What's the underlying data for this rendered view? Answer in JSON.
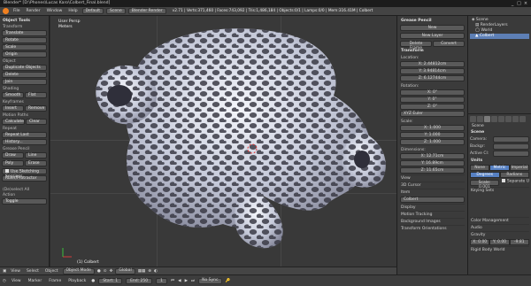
{
  "window": {
    "title": "Blender* [D:\\Phones\\Lucas Karo\\Colbert_Final.blend]",
    "controls": [
      "_",
      "□",
      "×"
    ]
  },
  "infobar": {
    "menus": [
      "File",
      "Render",
      "Window",
      "Help"
    ],
    "layout": "Default",
    "scene": "Scene",
    "engine": "Blender Render",
    "stats": "v2.71 | Verts:371,460 | Faces:743,092 | Tris:1,486,184 | Objects:0/1 | Lamps:0/0 | Mem:316.41M | Colbert"
  },
  "toolshelf": {
    "title": "Object Tools",
    "sections": {
      "transform": {
        "label": "Transform",
        "buttons": [
          "Translate",
          "Rotate",
          "Scale",
          "Origin"
        ]
      },
      "object": {
        "label": "Object",
        "buttons": [
          "Duplicate Objects",
          "Delete",
          "Join"
        ]
      },
      "shading": {
        "label": "Shading",
        "left": "Smooth",
        "right": "Flat"
      },
      "keyframes": {
        "label": "Keyframes",
        "left": "Insert",
        "right": "Remove"
      },
      "motion": {
        "label": "Motion Paths",
        "left": "Calculate",
        "right": "Clear"
      },
      "repeat": {
        "label": "Repeat",
        "buttons": [
          "Repeat Last",
          "History..."
        ]
      },
      "grease": {
        "label": "Grease Pencil",
        "draw": "Draw",
        "line": "Line",
        "poly": "Poly",
        "erase": "Erase",
        "sketch": "Use Sketching Sessions",
        "ruler": "Ruler/Protractor"
      },
      "op": {
        "label": "(De)select All",
        "action_label": "Action",
        "action_value": "Toggle"
      }
    }
  },
  "viewport": {
    "view_name": "User Persp",
    "units": "Meters",
    "object_label": "(1) Colbert"
  },
  "viewport_header": {
    "items": [
      "View",
      "Select",
      "Object"
    ],
    "mode": "Object Mode",
    "pivot": "Global"
  },
  "timeline": {
    "items": [
      "View",
      "Marker",
      "Frame",
      "Playback"
    ],
    "start": "Start: 1",
    "end": "End: 250",
    "current": "1",
    "sync": "No Sync"
  },
  "npanel": {
    "grease_title": "Grease Pencil",
    "new_btn": "New",
    "new_layer": "New Layer",
    "delete_frame": "Delete Frame",
    "convert": "Convert",
    "transform_title": "Transform",
    "location_label": "Location:",
    "location": [
      "X: 2.44812cm",
      "Y: 3.94814cm",
      "Z: 6.12744cm"
    ],
    "rotation_label": "Rotation:",
    "rotation": [
      "X: 0°",
      "Y: 0°",
      "Z: 0°"
    ],
    "rotation_mode": "XYZ Euler",
    "scale_label": "Scale:",
    "scale": [
      "X: 1.000",
      "Y: 1.000",
      "Z: 1.000"
    ],
    "dimensions_label": "Dimensions:",
    "dimensions": [
      "X: 12.71cm",
      "Y: 16.89cm",
      "Z: 11.65cm"
    ],
    "view": "View",
    "cursor": "3D Cursor",
    "item": "Item",
    "item_name": "Colbert",
    "display": "Display",
    "motion_tracking": "Motion Tracking",
    "background_images": "Background Images",
    "transform_orientations": "Transform Orientations"
  },
  "outliner": {
    "rows": [
      "Scene",
      "RenderLayers",
      "World",
      "Colbert"
    ]
  },
  "properties": {
    "scene_label": "Scene",
    "scene_section": "Scene",
    "camera_label": "Camera:",
    "background_label": "Backgr:",
    "active_label": "Active Cl:",
    "units_label": "Units",
    "units_opts": [
      "None",
      "Metric",
      "Imperial"
    ],
    "degrees": "Degrees",
    "radians": "Radians",
    "scale_val": "Scale: 0.001",
    "separate": "Separate U",
    "keying": "Keying Sets",
    "color_mgmt": "Color Management",
    "audio": "Audio",
    "gravity": "Gravity",
    "gravity_vals": [
      "X: 0.00",
      "Y: 0.00",
      "-9.81"
    ],
    "rigid": "Rigid Body World"
  },
  "colors": {
    "accent_blue": "#5680c2",
    "mesh_light": "#e8ecf4",
    "mesh_shadow": "#7d7f92"
  }
}
